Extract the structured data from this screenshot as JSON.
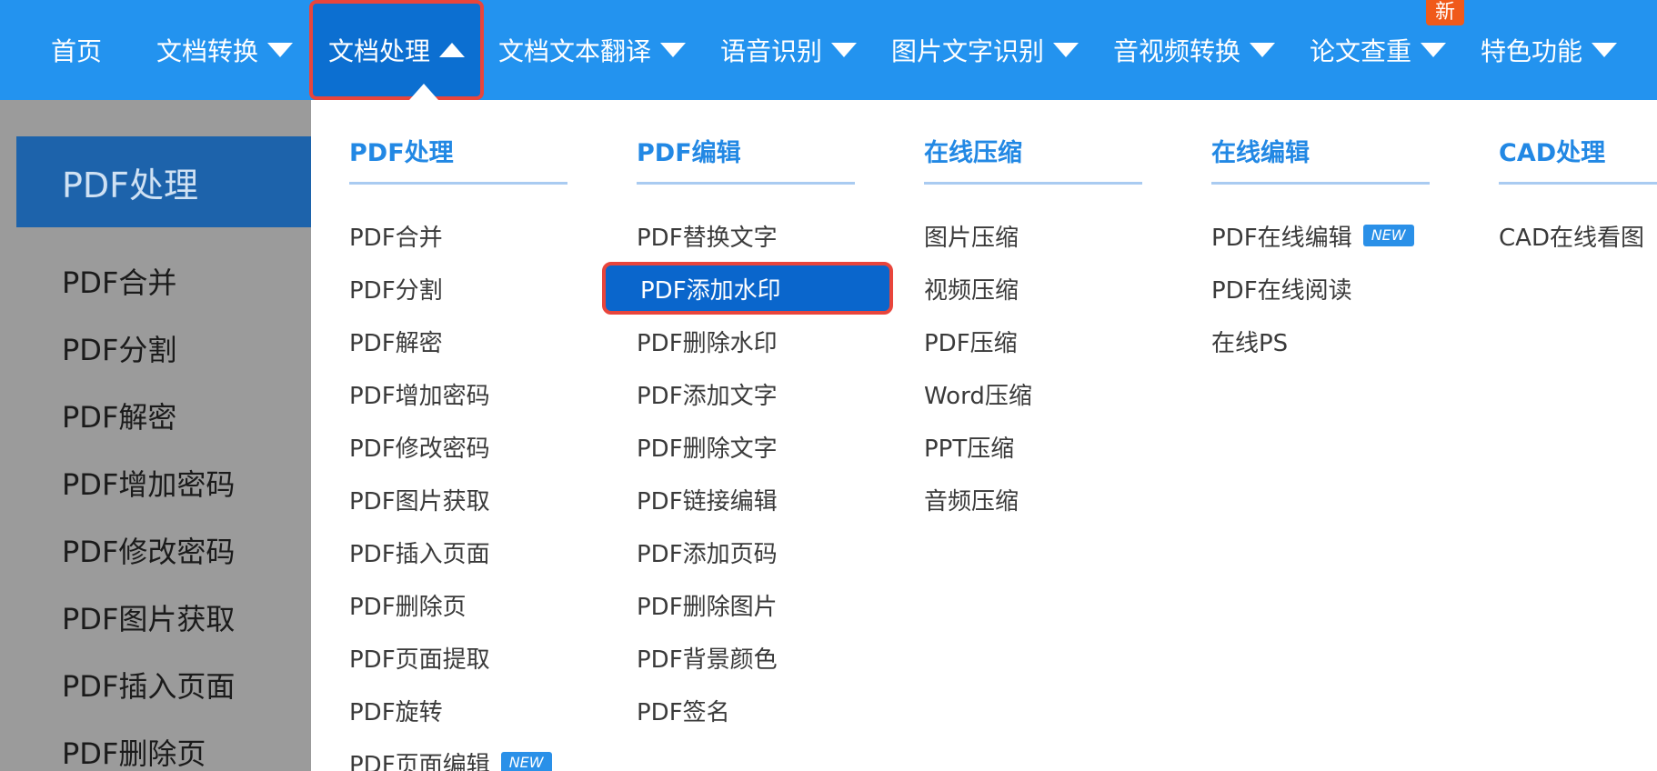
{
  "topnav": {
    "items": [
      {
        "label": "首页"
      },
      {
        "label": "文档转换"
      },
      {
        "label": "文档处理"
      },
      {
        "label": "文档文本翻译"
      },
      {
        "label": "语音识别"
      },
      {
        "label": "图片文字识别"
      },
      {
        "label": "音视频转换"
      },
      {
        "label": "论文查重"
      },
      {
        "label": "特色功能"
      }
    ],
    "new_badge": "新"
  },
  "sidebar": {
    "title": "PDF处理",
    "items": [
      "PDF合并",
      "PDF分割",
      "PDF解密",
      "PDF增加密码",
      "PDF修改密码",
      "PDF图片获取",
      "PDF插入页面",
      "PDF删除页"
    ]
  },
  "menu": {
    "new_tag": "NEW",
    "columns": [
      {
        "title": "PDF处理",
        "items": [
          "PDF合并",
          "PDF分割",
          "PDF解密",
          "PDF增加密码",
          "PDF修改密码",
          "PDF图片获取",
          "PDF插入页面",
          "PDF删除页",
          "PDF页面提取",
          "PDF旋转",
          "PDF页面编辑"
        ]
      },
      {
        "title": "PDF编辑",
        "items": [
          "PDF替换文字",
          "PDF添加水印",
          "PDF删除水印",
          "PDF添加文字",
          "PDF删除文字",
          "PDF链接编辑",
          "PDF添加页码",
          "PDF删除图片",
          "PDF背景颜色",
          "PDF签名"
        ]
      },
      {
        "title": "在线压缩",
        "items": [
          "图片压缩",
          "视频压缩",
          "PDF压缩",
          "Word压缩",
          "PPT压缩",
          "音频压缩"
        ]
      },
      {
        "title": "在线编辑",
        "items": [
          "PDF在线编辑",
          "PDF在线阅读",
          "在线PS"
        ]
      },
      {
        "title": "CAD处理",
        "items": [
          "CAD在线看图"
        ]
      }
    ]
  },
  "colors": {
    "nav_bg": "#2393ef",
    "nav_active": "#0c6fd1",
    "highlight_border": "#e8453c",
    "menu_heading": "#2288e4",
    "selected_bg": "#0a66cc",
    "sidebar_head_bg": "#1d63ab",
    "shade": "#9b9b9b"
  }
}
